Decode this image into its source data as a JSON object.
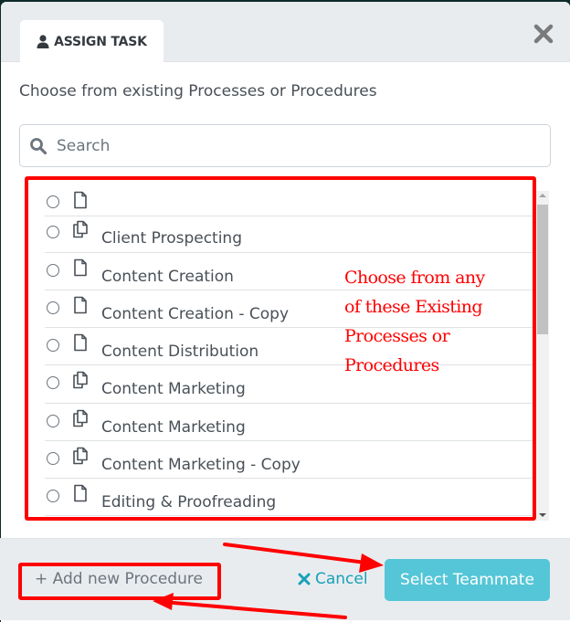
{
  "modal": {
    "tab_label": "ASSIGN TASK",
    "tab_icon": "user-icon",
    "close_icon": "close-icon"
  },
  "intro_text": "Choose from existing Processes or Procedures",
  "search": {
    "placeholder": "Search",
    "value": "",
    "icon": "search-icon"
  },
  "list": {
    "items": [
      {
        "label": "",
        "icon": "file-icon",
        "selected": false
      },
      {
        "label": "Client Prospecting",
        "icon": "copy-icon",
        "selected": false
      },
      {
        "label": "Content Creation",
        "icon": "file-icon",
        "selected": false
      },
      {
        "label": "Content Creation - Copy",
        "icon": "file-icon",
        "selected": false
      },
      {
        "label": "Content Distribution",
        "icon": "file-icon",
        "selected": false
      },
      {
        "label": "Content Marketing",
        "icon": "copy-icon",
        "selected": false
      },
      {
        "label": "Content Marketing",
        "icon": "copy-icon",
        "selected": false
      },
      {
        "label": "Content Marketing - Copy",
        "icon": "copy-icon",
        "selected": false
      },
      {
        "label": "Editing & Proofreading",
        "icon": "file-icon",
        "selected": false
      }
    ]
  },
  "annotation": {
    "text": "Choose from any of these Existing Processes or Procedures",
    "color": "#ff0000"
  },
  "footer": {
    "add_label": "+ Add new Procedure",
    "cancel_label": "Cancel",
    "cancel_icon": "times-icon",
    "select_label": "Select Teammate"
  },
  "colors": {
    "accent": "#54c6d7",
    "link": "#17a2b8",
    "annotation": "#ff0000"
  }
}
